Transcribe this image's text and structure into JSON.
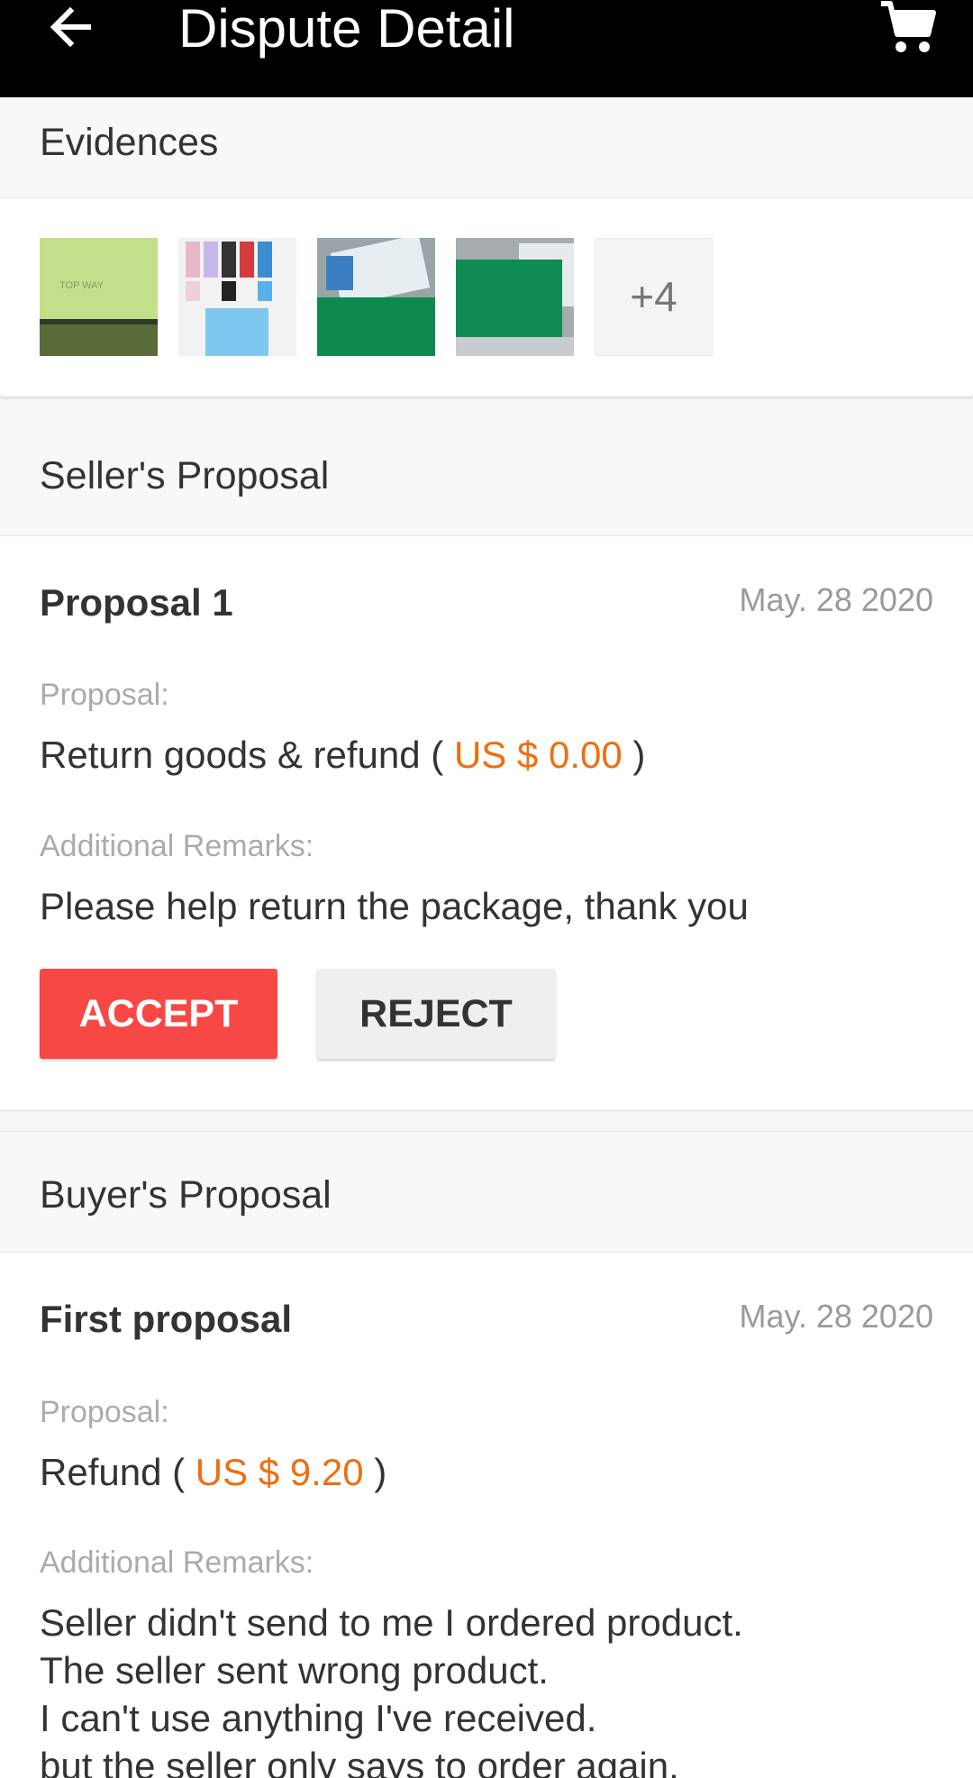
{
  "header": {
    "title": "Dispute Detail",
    "back_icon": "arrow-left-icon",
    "cart_icon": "cart-icon"
  },
  "evidences": {
    "title": "Evidences",
    "more_count": "+4",
    "thumbnails": [
      "evidence-photo-1",
      "evidence-photo-2",
      "evidence-photo-3",
      "evidence-photo-4"
    ],
    "thumb1_text": "TOP WAY"
  },
  "seller": {
    "section_title": "Seller's Proposal",
    "proposal_title": "Proposal 1",
    "date": "May. 28 2020",
    "proposal_label": "Proposal:",
    "proposal_prefix": "Return goods & refund (",
    "proposal_amount": "US $ 0.00",
    "proposal_suffix": ")",
    "remarks_label": "Additional Remarks:",
    "remarks": "Please help return the package, thank you",
    "accept_label": "ACCEPT",
    "reject_label": "REJECT"
  },
  "buyer": {
    "section_title": "Buyer's Proposal",
    "proposal_title": "First proposal",
    "date": "May. 28 2020",
    "proposal_label": "Proposal:",
    "proposal_prefix": "Refund (",
    "proposal_amount": "US $ 9.20",
    "proposal_suffix": ")",
    "remarks_label": "Additional Remarks:",
    "remarks_lines": [
      "Seller didn't send to me I ordered product.",
      "The seller sent wrong product.",
      "I can't use anything I've received.",
      "but the seller only says to order again."
    ]
  },
  "colors": {
    "accent_price": "#ee6f11",
    "accept": "#f74845",
    "topbar": "#000000"
  }
}
